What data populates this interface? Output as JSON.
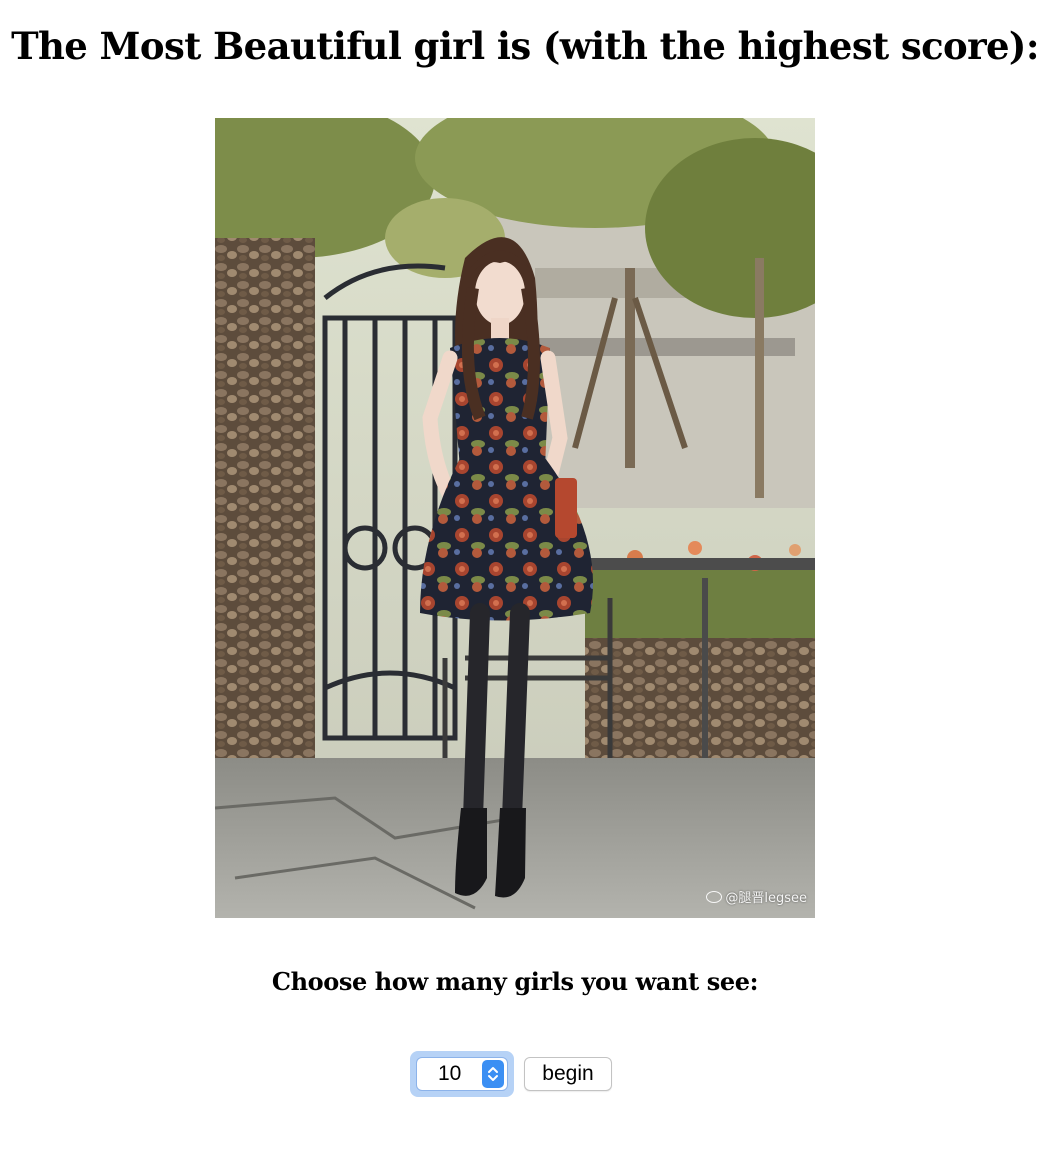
{
  "header": {
    "title": "The Most Beautiful girl is (with the highest score):"
  },
  "photo": {
    "subject": "woman in floral dress standing by a gate",
    "watermark": "@腿晋legsee"
  },
  "prompt": {
    "label": "Choose how many girls you want see:"
  },
  "controls": {
    "count_select": {
      "selected": "10"
    },
    "begin_label": "begin"
  },
  "icons": {
    "select_arrows": "up-down-chevron-icon",
    "weibo": "weibo-logo-icon"
  },
  "colors": {
    "focus_ring": "#b6d2f6",
    "select_arrow_bg": "#3b8ff3"
  }
}
